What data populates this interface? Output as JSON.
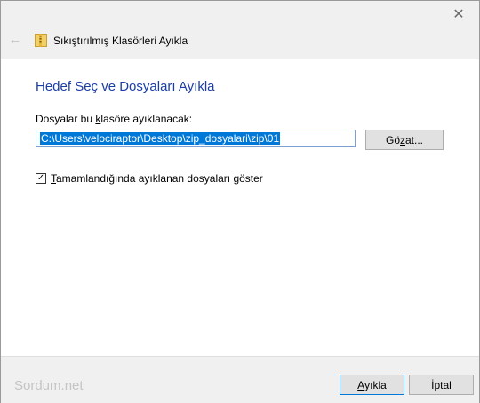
{
  "window": {
    "title": "Sıkıştırılmış Klasörleri Ayıkla",
    "close_glyph": "✕",
    "back_glyph": "←"
  },
  "content": {
    "heading": "Hedef Seç ve Dosyaları Ayıkla",
    "dest_label_pre": "Dosyalar bu ",
    "dest_label_ul": "k",
    "dest_label_post": "lasöre ayıklanacak:",
    "path_value": "C:\\Users\\velociraptor\\Desktop\\zip_dosyalari\\zip\\01",
    "browse_pre": "Gö",
    "browse_ul": "z",
    "browse_post": "at...",
    "checkbox_ul": "T",
    "checkbox_post": "amamlandığında ayıklanan dosyaları göster",
    "checkbox_checked": true,
    "check_glyph": "✓"
  },
  "footer": {
    "watermark": "Sordum.net",
    "extract_ul": "A",
    "extract_post": "yıkla",
    "cancel_label": "İptal"
  },
  "colors": {
    "heading": "#1a3da8",
    "selection": "#0078d7",
    "default_button_border": "#0078d7"
  }
}
